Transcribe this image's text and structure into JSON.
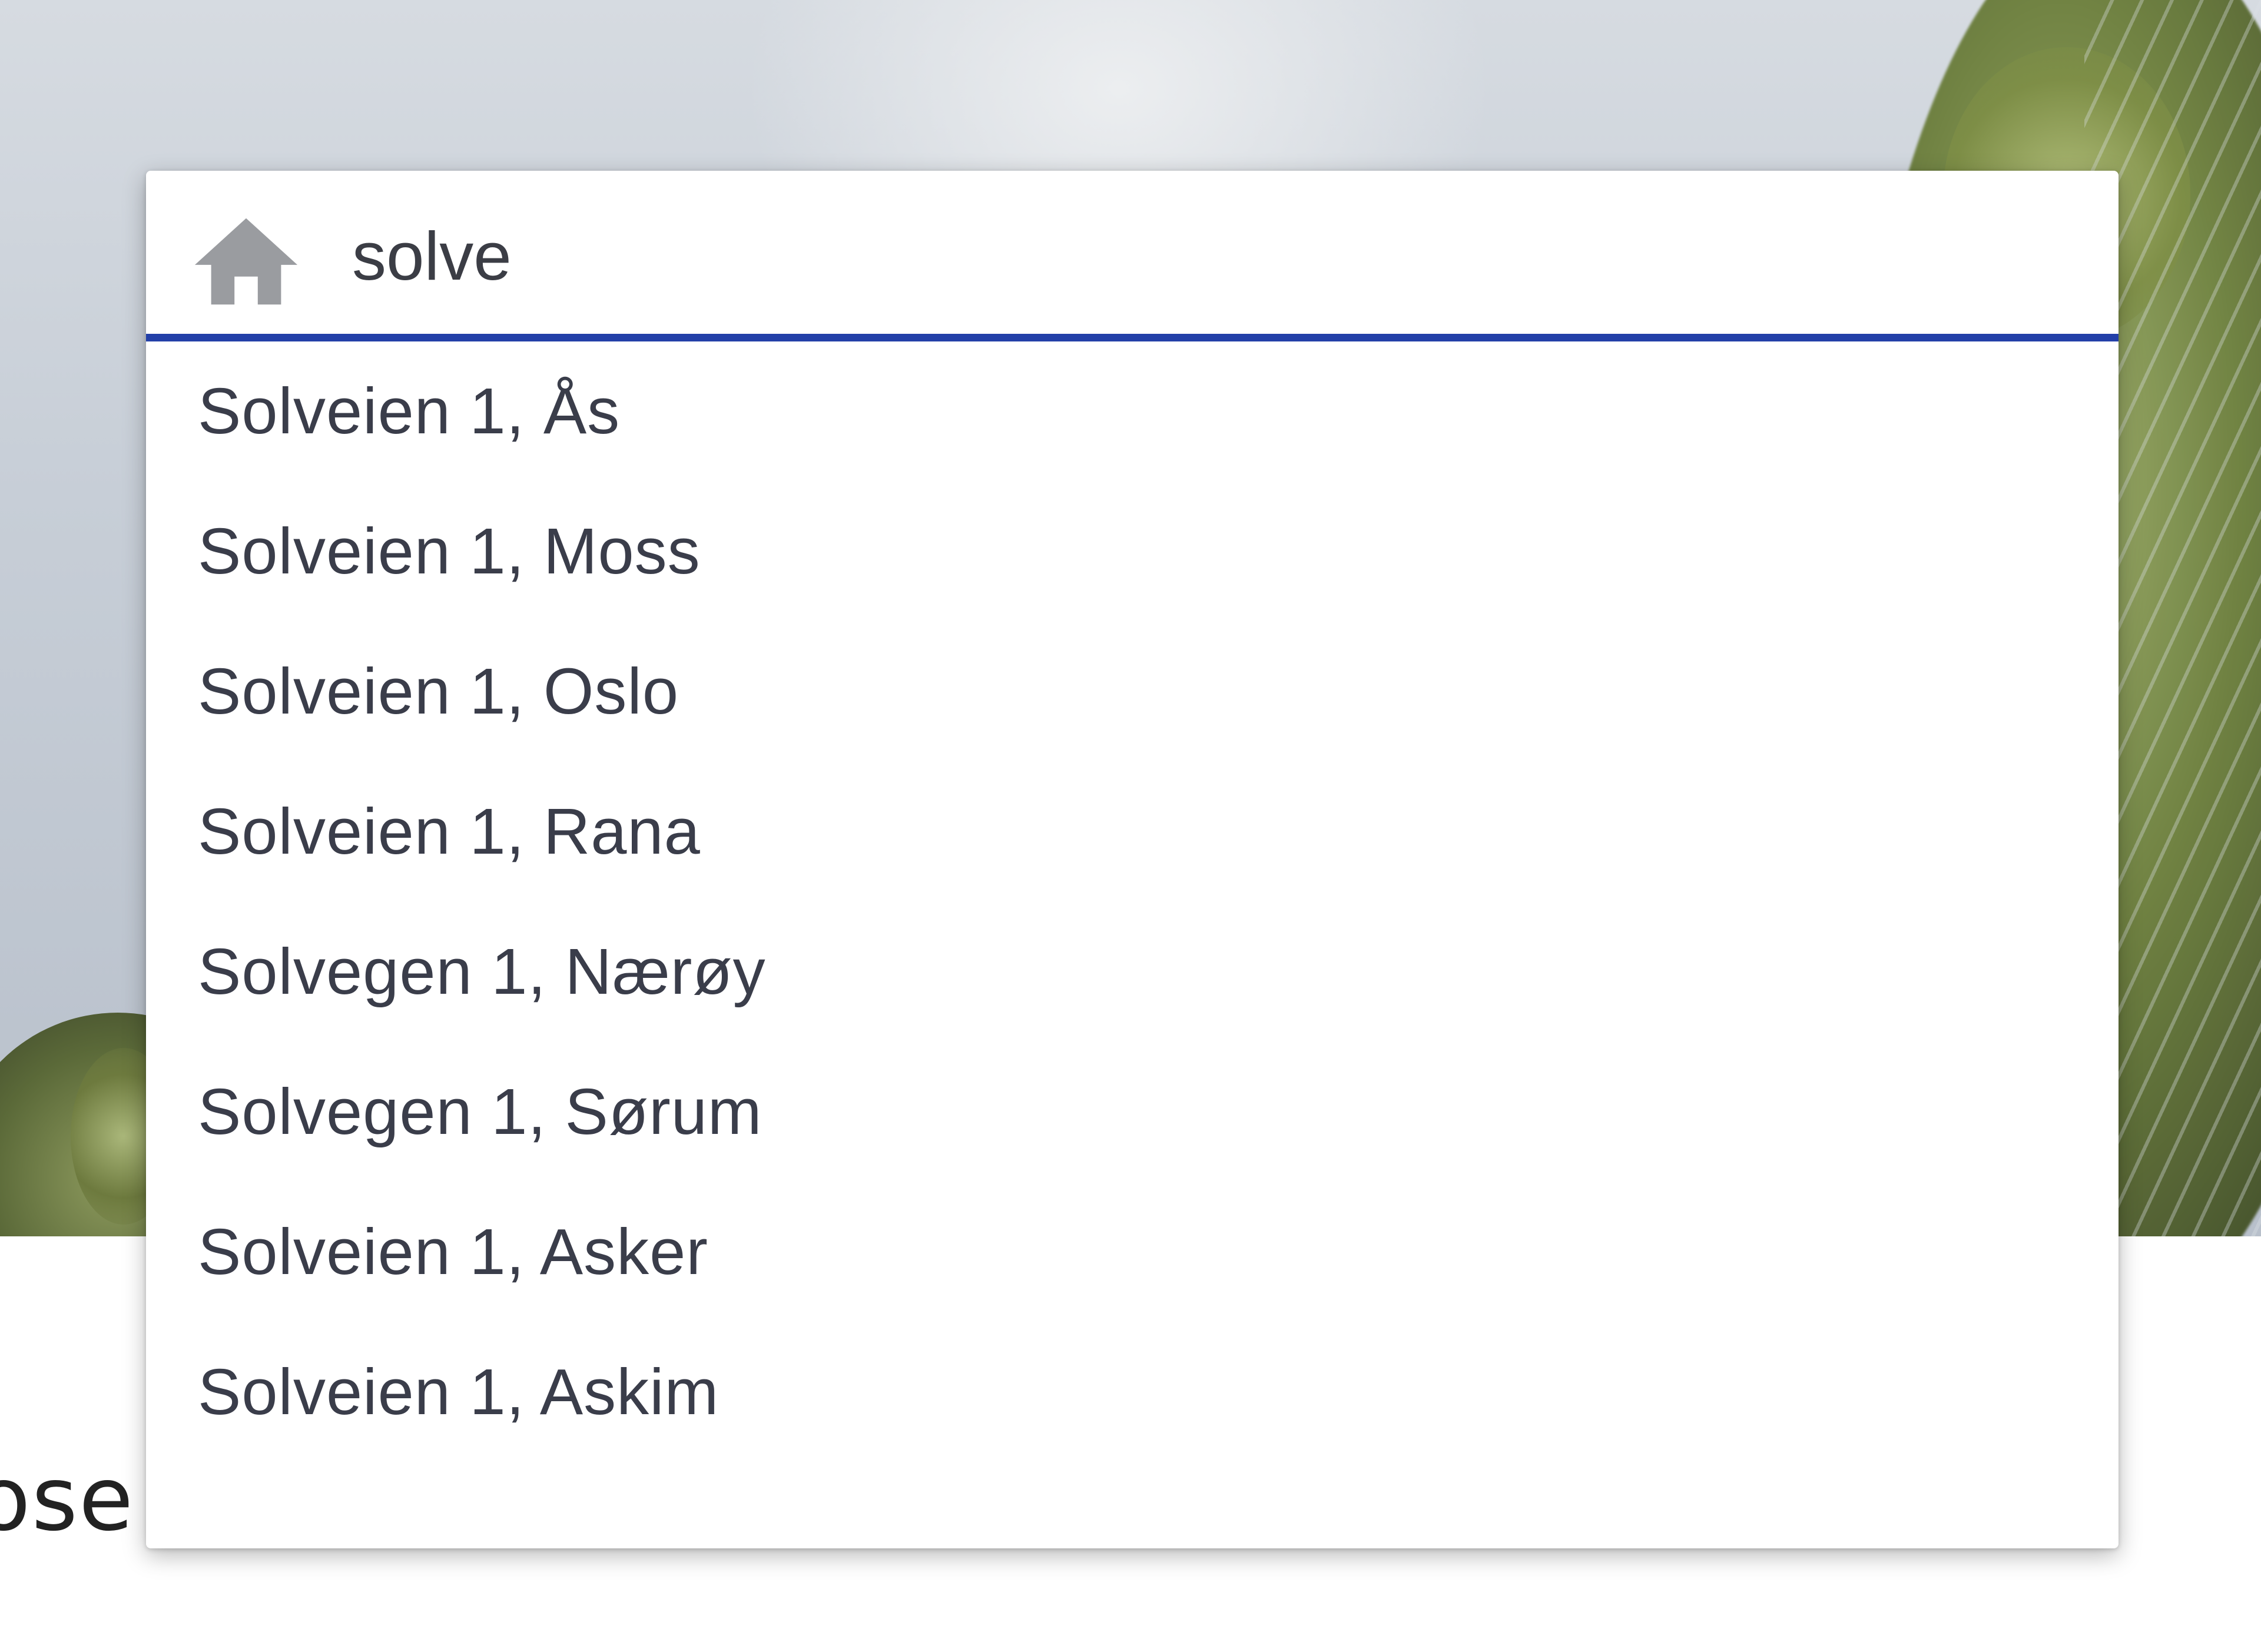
{
  "search": {
    "value": "solve",
    "placeholder": ""
  },
  "results": [
    "Solveien 1, Ås",
    "Solveien 1, Moss",
    "Solveien 1, Oslo",
    "Solveien 1, Rana",
    "Solvegen 1, Nærøy",
    "Solvegen 1, Sørum",
    "Solveien 1, Asker",
    "Solveien 1, Askim"
  ],
  "background": {
    "partial_text": "ose"
  },
  "colors": {
    "accent": "#2340a8",
    "icon": "#9a9ca0",
    "text": "#3a3d4a"
  },
  "icons": {
    "search_field": "home-icon"
  }
}
